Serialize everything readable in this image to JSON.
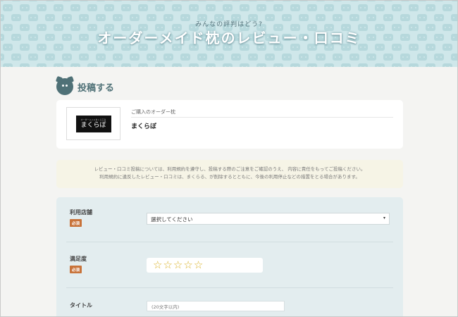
{
  "header": {
    "subtitle": "みんなの評判はどう?",
    "title": "オーダーメイド枕のレビュー・口コミ"
  },
  "section": {
    "title": "投稿する"
  },
  "product": {
    "label": "ご購入のオーダー枕",
    "name": "まくらぼ",
    "logo_text": "まくらぼ",
    "logo_small": "オーダーメイドまくら工房"
  },
  "notice": {
    "line1": "レビュー・口コミ投稿については、利用規約を遵守し、投稿する際のご注意をご確認のうえ、 内容に責任をもってご投稿ください。",
    "line2": "利用規約に違反したレビュー・口コミは、まくらる、が削除するとともに、今後の利用停止などの措置をとる場合があります。"
  },
  "form": {
    "store": {
      "label": "利用店舗",
      "required": "必須",
      "value": "選択してください",
      "arrow": "▾"
    },
    "satisfaction": {
      "label": "満足度",
      "required": "必須",
      "stars": [
        "☆",
        "☆",
        "☆",
        "☆",
        "☆"
      ],
      "rating": 0
    },
    "title": {
      "label": "タイトル",
      "placeholder": "(20文字以内)"
    }
  },
  "colors": {
    "header_bg": "#cfe7ea",
    "accent": "#4f7177",
    "required": "#c8733a",
    "star": "#d9b32a"
  }
}
